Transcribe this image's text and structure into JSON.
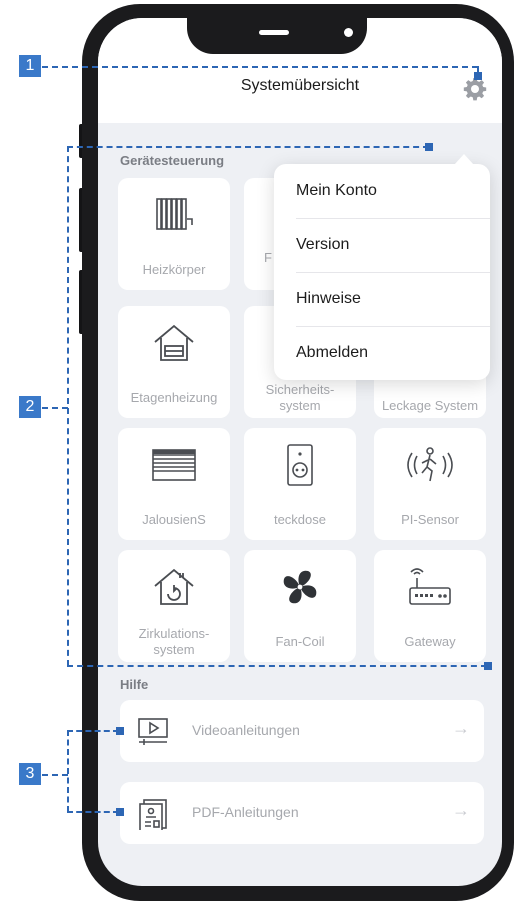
{
  "header": {
    "title": "Systemübersicht"
  },
  "sections": {
    "devices_title": "Gerätesteuerung",
    "help_title": "Hilfe"
  },
  "tiles": [
    {
      "label": "Heizkörper",
      "icon": "radiator-icon"
    },
    {
      "label": "F",
      "icon": "floor-heating-icon"
    },
    {
      "label": "",
      "icon": "unknown-icon"
    },
    {
      "label": "Etagenheizung",
      "icon": "house-heating-icon"
    },
    {
      "label": "Sicherheits-system",
      "icon": "security-icon"
    },
    {
      "label": "Leckage System",
      "icon": "leakage-icon"
    },
    {
      "label": "JalousienS",
      "icon": "blinds-icon"
    },
    {
      "label": "teckdose",
      "icon": "socket-icon"
    },
    {
      "label": "PI-Sensor",
      "icon": "motion-sensor-icon"
    },
    {
      "label": "Zirkulations-system",
      "icon": "circulation-icon"
    },
    {
      "label": "Fan-Coil",
      "icon": "fan-icon"
    },
    {
      "label": "Gateway",
      "icon": "router-icon"
    }
  ],
  "help": [
    {
      "label": "Videoanleitungen",
      "icon": "video-icon",
      "arrow": "→"
    },
    {
      "label": "PDF-Anleitungen",
      "icon": "pdf-document-icon",
      "arrow": "→"
    }
  ],
  "menu": {
    "items": [
      "Mein Konto",
      "Version",
      "Hinweise",
      "Abmelden"
    ]
  },
  "callouts": [
    "1",
    "2",
    "3"
  ],
  "colors": {
    "accent": "#3a79c9",
    "screen_bg": "#eef0f4",
    "phone_frame": "#1b1b1d"
  }
}
